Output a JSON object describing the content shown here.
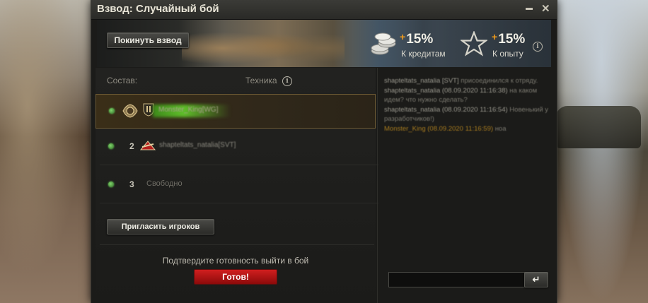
{
  "window": {
    "title": "Взвод: Случайный бой",
    "minimize": "▬",
    "close": "✕"
  },
  "banner": {
    "leave_label": "Покинуть взвод",
    "credits": {
      "plus": "+",
      "value": "15%",
      "label": "К кредитам",
      "icon": "coins-icon"
    },
    "xp": {
      "plus": "+",
      "value": "15%",
      "label": "К опыту",
      "icon": "star-icon"
    },
    "info_glyph": "i"
  },
  "roster": {
    "header_composition": "Состав:",
    "header_vehicles": "Техника",
    "info_glyph": "i",
    "slots": [
      {
        "number": "",
        "player": "Monster_King[WG]",
        "status": "ready",
        "badge": "clan-emblem-icon"
      },
      {
        "number": "2",
        "player": "shapteltats_natalia[SVT]",
        "status": "ready",
        "badge": "rank-badge-icon"
      },
      {
        "number": "3",
        "free_label": "Свободно",
        "status": "empty"
      }
    ],
    "invite_label": "Пригласить игроков",
    "ready_prompt": "Подтвердите готовность выйти в бой",
    "ready_label": "Готов!"
  },
  "chat": {
    "messages": [
      {
        "author": "shapteltats_natalia [SVT]",
        "text": "присоединился к отряду."
      },
      {
        "author": "shapteltats_natalia (08.09.2020 11:16:38)",
        "text": "на каком идем? что нужно сделать?"
      },
      {
        "author": "shapteltats_natalia (08.09.2020 11:16:54)",
        "text": "Новенький у разработчиков!)"
      },
      {
        "author": "Monster_King (08.09.2020 11:16:59)",
        "text": "ноа",
        "self": true
      }
    ],
    "input_value": "",
    "send_glyph": "↵"
  },
  "colors": {
    "accent_orange": "#f39c1a",
    "ready_red": "#c41414",
    "active_border": "#6d5a34"
  }
}
